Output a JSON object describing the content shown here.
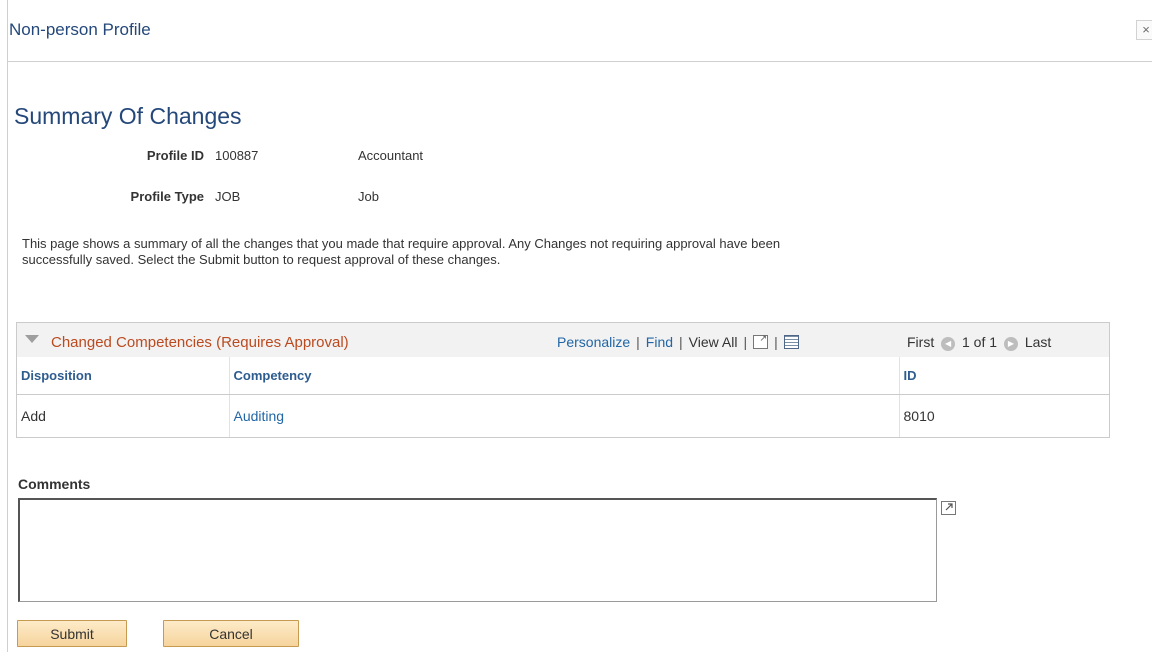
{
  "modal": {
    "title": "Non-person Profile",
    "close_glyph": "×"
  },
  "page": {
    "title": "Summary Of Changes"
  },
  "profile": {
    "id_label": "Profile ID",
    "id_value": "100887",
    "id_description": "Accountant",
    "type_label": "Profile Type",
    "type_value": "JOB",
    "type_description": "Job"
  },
  "intro_text": "This page shows a summary of all the changes that you made that require approval. Any Changes not requiring approval have been successfully saved. Select the Submit button to request approval of these changes.",
  "grid": {
    "title": "Changed Competencies (Requires Approval)",
    "nav": {
      "personalize": "Personalize",
      "find": "Find",
      "view_all": "View All",
      "separator": "|"
    },
    "pager": {
      "first": "First",
      "range": "1 of 1",
      "last": "Last"
    },
    "columns": [
      "Disposition",
      "Competency",
      "ID"
    ],
    "rows": [
      {
        "disposition": "Add",
        "competency": "Auditing",
        "id": "8010"
      }
    ],
    "colors": {
      "title": "#bb4a1f",
      "link": "#2266a5",
      "header": "#2e5c8f"
    }
  },
  "comments": {
    "label": "Comments",
    "value": ""
  },
  "buttons": {
    "submit": "Submit",
    "cancel": "Cancel"
  },
  "icons": [
    "close-icon",
    "collapse-triangle-icon",
    "zoom-grid-icon",
    "download-spreadsheet-icon",
    "previous-arrow-icon",
    "next-arrow-icon",
    "expand-textarea-icon"
  ]
}
